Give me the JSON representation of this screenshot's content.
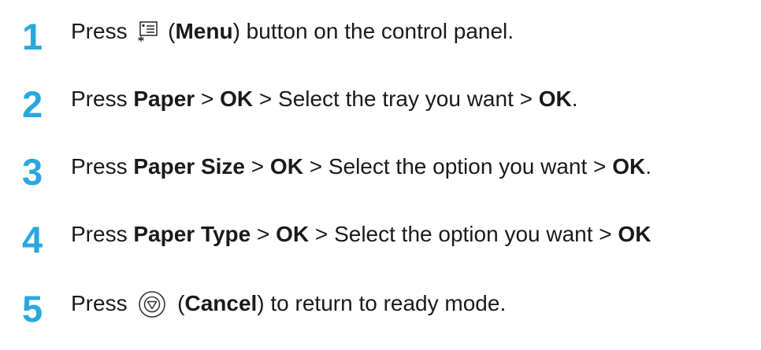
{
  "steps": [
    {
      "number": "1",
      "press": "Press",
      "open_paren": "(",
      "menu_label": "Menu",
      "menu_rest": ") button on the control panel.",
      "icon": "menu-icon"
    },
    {
      "number": "2",
      "press": "Press",
      "paper": "Paper",
      "sep1": " > ",
      "ok1": "OK",
      "mid": " > Select the tray you want > ",
      "ok2": "OK",
      "end": "."
    },
    {
      "number": "3",
      "press": "Press",
      "paper_size": "Paper Size",
      "sep1": " > ",
      "ok1": "OK",
      "mid": " > Select the option you want > ",
      "ok2": "OK",
      "end": "."
    },
    {
      "number": "4",
      "press": "Press",
      "paper_type": "Paper Type",
      "sep1": " > ",
      "ok1": "OK",
      "mid": " > Select the option you want > ",
      "ok2": "OK"
    },
    {
      "number": "5",
      "press": "Press",
      "open_paren": "(",
      "cancel_label": "Cancel",
      "cancel_rest": ") to return to ready mode.",
      "icon": "cancel-icon"
    }
  ],
  "colors": {
    "step_number": "#29a8e0",
    "text": "#1a1a1a"
  }
}
